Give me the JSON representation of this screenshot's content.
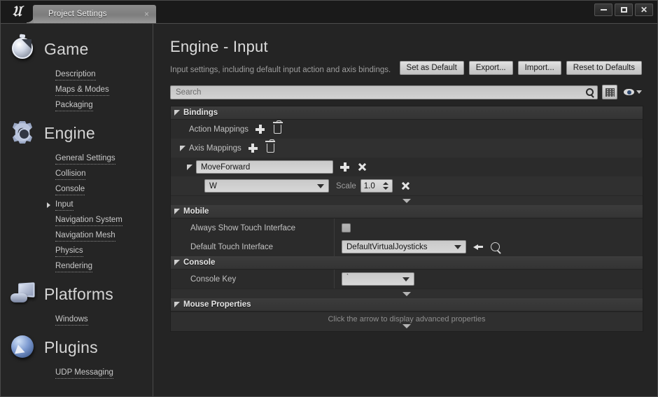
{
  "window": {
    "app_icon": "unreal-logo-icon",
    "tab_label": "Project Settings",
    "tab_close": "×",
    "controls": {
      "minimize": "minimize-icon",
      "maximize": "maximize-icon",
      "close": "close-icon"
    }
  },
  "sidebar": {
    "groups": [
      {
        "title": "Game",
        "icon": "stopwatch-icon",
        "items": [
          {
            "label": "Description",
            "expandable": false
          },
          {
            "label": "Maps & Modes",
            "expandable": false
          },
          {
            "label": "Packaging",
            "expandable": false
          }
        ]
      },
      {
        "title": "Engine",
        "icon": "gear-icon",
        "items": [
          {
            "label": "General Settings",
            "expandable": false
          },
          {
            "label": "Collision",
            "expandable": false
          },
          {
            "label": "Console",
            "expandable": false
          },
          {
            "label": "Input",
            "expandable": true
          },
          {
            "label": "Navigation System",
            "expandable": false
          },
          {
            "label": "Navigation Mesh",
            "expandable": false
          },
          {
            "label": "Physics",
            "expandable": false
          },
          {
            "label": "Rendering",
            "expandable": false
          }
        ]
      },
      {
        "title": "Platforms",
        "icon": "platform-icon",
        "items": [
          {
            "label": "Windows",
            "expandable": false
          }
        ]
      },
      {
        "title": "Plugins",
        "icon": "plugin-icon",
        "items": [
          {
            "label": "UDP Messaging",
            "expandable": false
          }
        ]
      }
    ]
  },
  "main": {
    "page_title": "Engine - Input",
    "page_description": "Input settings, including default input action and axis bindings.",
    "toolbar": [
      {
        "label": "Set as Default"
      },
      {
        "label": "Export..."
      },
      {
        "label": "Import..."
      },
      {
        "label": "Reset to Defaults"
      }
    ],
    "search": {
      "placeholder": "Search",
      "value": ""
    },
    "view_buttons": {
      "grid": "grid-icon",
      "eye": "eye-icon"
    }
  },
  "sections": {
    "bindings": {
      "title": "Bindings",
      "action_mappings": {
        "label": "Action Mappings",
        "add": "plus-icon",
        "delete": "trash-icon"
      },
      "axis_mappings": {
        "label": "Axis Mappings",
        "add": "plus-icon",
        "delete": "trash-icon"
      },
      "axis_entry": {
        "name": "MoveForward",
        "add": "plus-icon",
        "remove": "close-icon",
        "key": "W",
        "scale_label": "Scale",
        "scale_value": "1.0",
        "key_remove": "close-icon"
      }
    },
    "mobile": {
      "title": "Mobile",
      "rows": [
        {
          "label": "Always Show Touch Interface",
          "type": "checkbox",
          "checked": false
        },
        {
          "label": "Default Touch Interface",
          "type": "asset",
          "value": "DefaultVirtualJoysticks"
        }
      ]
    },
    "console": {
      "title": "Console",
      "rows": [
        {
          "label": "Console Key",
          "type": "combo",
          "value": "`"
        }
      ]
    },
    "mouse_properties": {
      "title": "Mouse Properties",
      "advanced_hint": "Click the arrow to display advanced properties"
    }
  },
  "colors": {
    "window_bg": "#242424",
    "panel_bg": "#2b2b2b",
    "section_header": "#3c3c3c",
    "text_primary": "#dcdcdc",
    "text_muted": "#9d9d9d",
    "field_bg": "#d2d2d2"
  }
}
